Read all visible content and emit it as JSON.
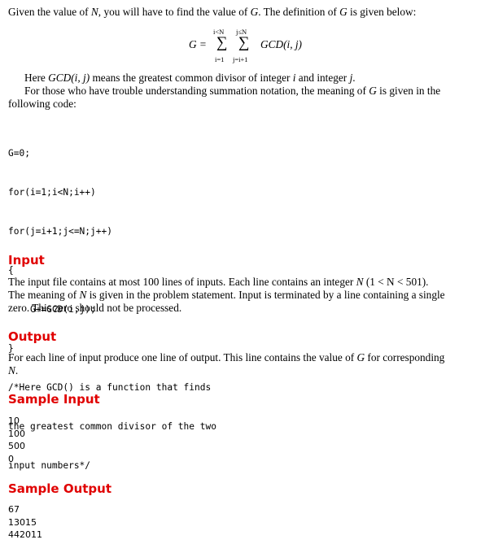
{
  "intro": {
    "given_pre": "Given the value of ",
    "var_n": "N",
    "given_mid": ", you will have to find the value of ",
    "var_g": "G",
    "given_post": ". The definition of ",
    "var_g2": "G",
    "given_end": " is given below:"
  },
  "formula": {
    "lhs": "G =",
    "sum_symbol": "∑",
    "outer_upper": "i<N",
    "outer_lower": "i=1",
    "inner_upper": "j≤N",
    "inner_lower": "j=i+1",
    "term": "GCD(i, j)"
  },
  "explanation": {
    "line1_pre": "Here ",
    "line1_gcd": "GCD(i, j)",
    "line1_mid": " means the greatest common divisor of integer ",
    "line1_i": "i",
    "line1_and": " and integer ",
    "line1_j": "j",
    "line1_end": ".",
    "line2_pre": "For those who have trouble understanding summation notation, the meaning of ",
    "line2_g": "G",
    "line2_mid": " is given in the",
    "line3": "following code:"
  },
  "code": {
    "lines": [
      "G=0;",
      "for(i=1;i<N;i++)",
      "for(j=i+1;j<=N;j++)",
      "{",
      "    G+=GCD(i,j);",
      "}",
      "/*Here GCD() is a function that finds",
      "the greatest common divisor of the two",
      "input numbers*/"
    ]
  },
  "input_section": {
    "heading": "Input",
    "line1_pre": "The input file contains at most 100 lines of inputs. Each line contains an integer ",
    "line1_n": "N",
    "line1_range": " (1 < N < 501).",
    "line2_pre": "The meaning of ",
    "line2_n": "N",
    "line2_post": " is given in the problem statement. Input is terminated by a line containing a single",
    "line3": "zero. This zero should not be processed."
  },
  "output_section": {
    "heading": "Output",
    "line1_pre": "For each line of input produce one line of output. This line contains the value of ",
    "line1_g": "G",
    "line1_post": " for corresponding",
    "line2_n": "N",
    "line2_end": "."
  },
  "sample_input": {
    "heading": "Sample Input",
    "lines": [
      "10",
      "100",
      "500",
      "0"
    ]
  },
  "sample_output": {
    "heading": "Sample Output",
    "lines": [
      "67",
      "13015",
      "442011"
    ]
  }
}
